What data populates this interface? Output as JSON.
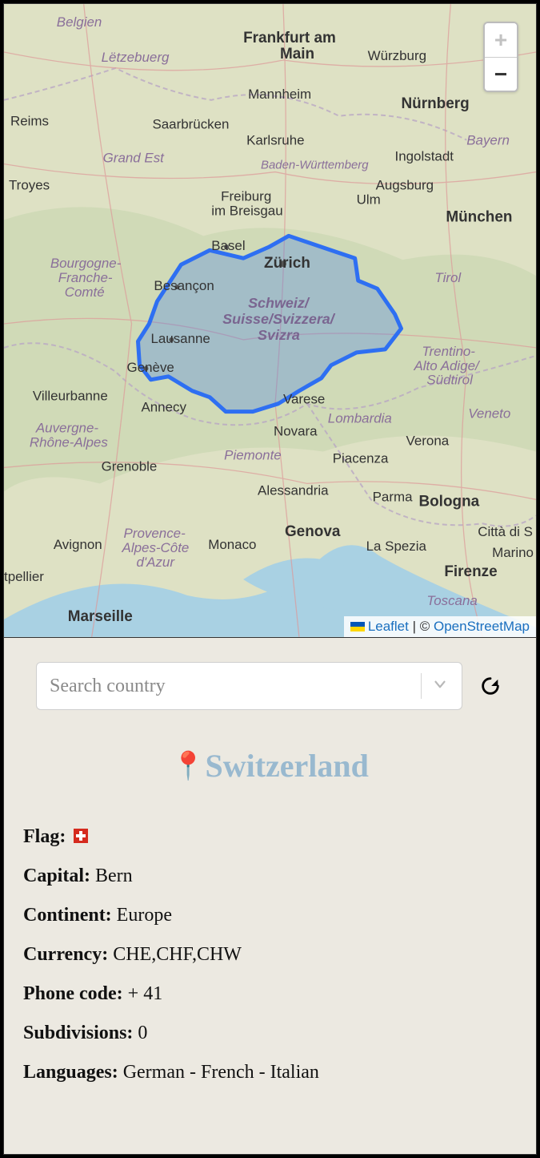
{
  "map": {
    "zoom_in_label": "+",
    "zoom_out_label": "−",
    "zoom_in_disabled": true,
    "attribution": {
      "leaflet": "Leaflet",
      "sep": " | © ",
      "osm": "OpenStreetMap"
    },
    "highlighted_country": "Switzerland",
    "labels": {
      "belgien": "Belgien",
      "letzebuerg": "Lëtzebuerg",
      "frankfurt": "Frankfurt am\nMain",
      "wurzburg": "Würzburg",
      "mannheim": "Mannheim",
      "nurnberg": "Nürnberg",
      "reims": "Reims",
      "saarbrucken": "Saarbrücken",
      "karlsruhe": "Karlsruhe",
      "bayern": "Bayern",
      "grandest": "Grand Est",
      "badenw": "Baden-Württemberg",
      "ingolstadt": "Ingolstadt",
      "augsburg": "Augsburg",
      "troyes": "Troyes",
      "freiburg": "Freiburg\nim Breisgau",
      "ulm": "Ulm",
      "munchen": "München",
      "bourgogne": "Bourgogne-\nFranche-\nComté",
      "basel": "Basel",
      "zurich": "Zürich",
      "tirol": "Tirol",
      "besancon": "Besançon",
      "schweiz": "Schweiz/\nSuisse/Svizzera/\nSvizra",
      "lausanne": "Lausanne",
      "geneve": "Genève",
      "trentino": "Trentino-\nAlto Adige/\nSüdtirol",
      "villeurbanne": "Villeurbanne",
      "annecy": "Annecy",
      "varese": "Varese",
      "veneto": "Veneto",
      "auvergne": "Auvergne-\nRhône-Alpes",
      "novara": "Novara",
      "lombardia": "Lombardia",
      "verona": "Verona",
      "piemonte": "Piemonte",
      "grenoble": "Grenoble",
      "piacenza": "Piacenza",
      "alessandria": "Alessandria",
      "parma": "Parma",
      "bologna": "Bologna",
      "provence": "Provence-\nAlpes-Côte\nd'Azur",
      "genova": "Genova",
      "monaco": "Monaco",
      "laspezia": "La Spezia",
      "cittadis": "Città di S",
      "marino": "Marino",
      "firenze": "Firenze",
      "avignon": "Avignon",
      "toscana": "Toscana",
      "marseille": "Marseille",
      "tpellier": "tpellier"
    }
  },
  "search": {
    "placeholder": "Search country"
  },
  "country": {
    "pin": "📍",
    "name": "Switzerland",
    "fields": {
      "flag_label": "Flag:",
      "capital_label": "Capital:",
      "capital": "Bern",
      "continent_label": "Continent:",
      "continent": "Europe",
      "currency_label": "Currency:",
      "currency": "CHE,CHF,CHW",
      "phone_label": "Phone code:",
      "phone": "+ 41",
      "subdiv_label": "Subdivisions:",
      "subdiv": "0",
      "lang_label": "Languages:",
      "lang": "German - French - Italian"
    }
  }
}
